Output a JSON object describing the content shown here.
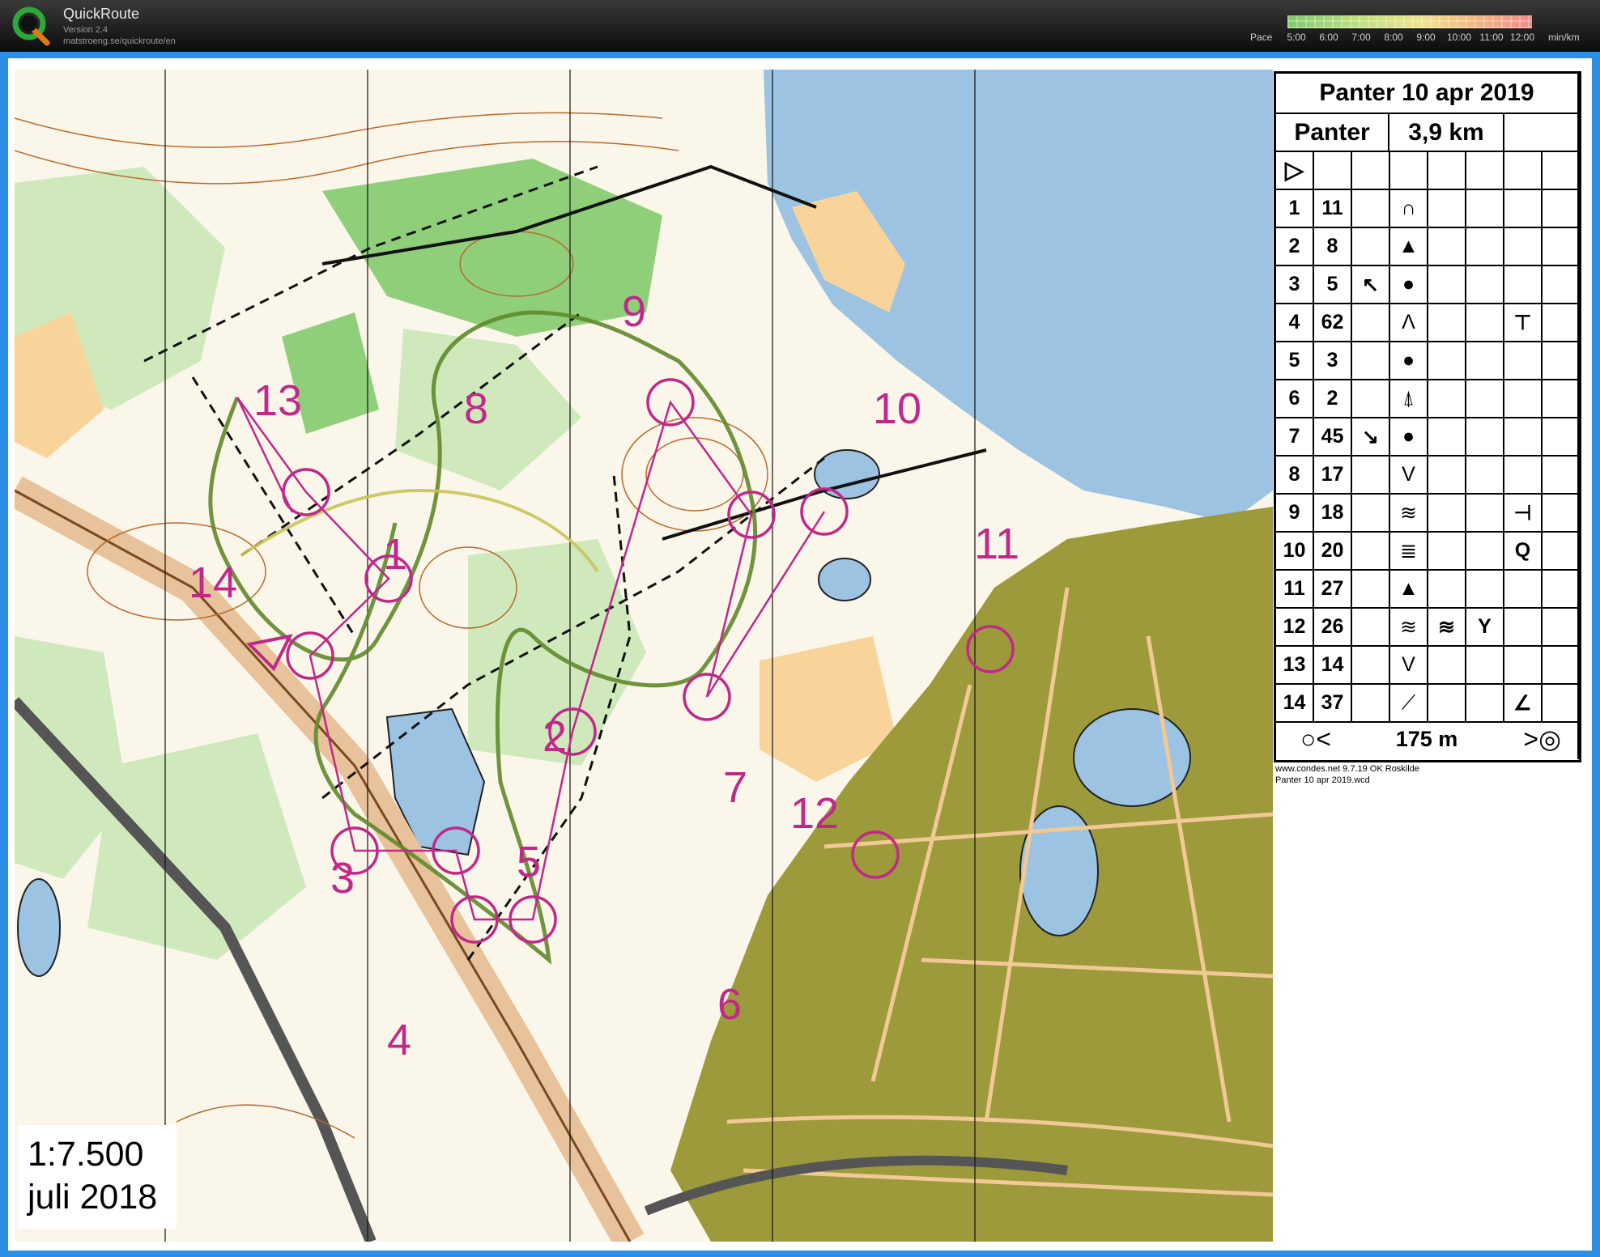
{
  "app": {
    "name": "QuickRoute",
    "version": "Version 2.4",
    "url": "matstroeng.se/quickroute/en",
    "logo_letter": "Q"
  },
  "pace_legend": {
    "label": "Pace",
    "ticks": [
      "5:00",
      "6:00",
      "7:00",
      "8:00",
      "9:00",
      "10:00",
      "11:00",
      "12:00"
    ],
    "unit": "min/km",
    "colors": [
      "#7fc86a",
      "#bde07e",
      "#efe28a",
      "#f4b47f",
      "#f28a8a"
    ]
  },
  "map": {
    "scale": "1:7.500",
    "date": "juli 2018",
    "colors": {
      "forest_green": "#8fcf7a",
      "light_green": "#cfe9bd",
      "water": "#9cc3e2",
      "open": "#f8d49b",
      "urban": "#9c9a3a",
      "course": "#c0288a",
      "route": "#5f8a2a",
      "contour": "#b86a2a"
    },
    "controls": [
      {
        "number": "1"
      },
      {
        "number": "2"
      },
      {
        "number": "3"
      },
      {
        "number": "4"
      },
      {
        "number": "5"
      },
      {
        "number": "6"
      },
      {
        "number": "7"
      },
      {
        "number": "8"
      },
      {
        "number": "9"
      },
      {
        "number": "10"
      },
      {
        "number": "11"
      },
      {
        "number": "12"
      },
      {
        "number": "13"
      },
      {
        "number": "14"
      }
    ]
  },
  "description_sheet": {
    "title": "Panter 10 apr 2019",
    "class_name": "Panter",
    "length": "3,9 km",
    "start_symbol": "▷",
    "rows": [
      {
        "no": "1",
        "code": "11",
        "dir": "",
        "feature": "∩"
      },
      {
        "no": "2",
        "code": "8",
        "dir": "",
        "feature": "▲"
      },
      {
        "no": "3",
        "code": "5",
        "dir": "↖",
        "feature": "●"
      },
      {
        "no": "4",
        "code": "62",
        "dir": "",
        "feature": "Λ",
        "extra": "⊤"
      },
      {
        "no": "5",
        "code": "3",
        "dir": "",
        "feature": "●"
      },
      {
        "no": "6",
        "code": "2",
        "dir": "",
        "feature": "⍋"
      },
      {
        "no": "7",
        "code": "45",
        "dir": "↘",
        "feature": "●"
      },
      {
        "no": "8",
        "code": "17",
        "dir": "",
        "feature": "V"
      },
      {
        "no": "9",
        "code": "18",
        "dir": "",
        "feature": "≋",
        "extra": "⊣"
      },
      {
        "no": "10",
        "code": "20",
        "dir": "",
        "feature": "≣",
        "extra": "Q"
      },
      {
        "no": "11",
        "code": "27",
        "dir": "",
        "feature": "▲"
      },
      {
        "no": "12",
        "code": "26",
        "dir": "",
        "feature": "≋",
        "feature2": "≋",
        "feature3": "Y"
      },
      {
        "no": "13",
        "code": "14",
        "dir": "",
        "feature": "V"
      },
      {
        "no": "14",
        "code": "37",
        "dir": "",
        "feature": "⟋",
        "extra": "∠"
      }
    ],
    "finish": {
      "start_marker": "○<",
      "distance": "175 m",
      "end_marker": ">◎"
    },
    "footer_software": "www.condes.net 9.7.19 OK Roskilde",
    "footer_file": "Panter 10 apr 2019.wcd"
  }
}
